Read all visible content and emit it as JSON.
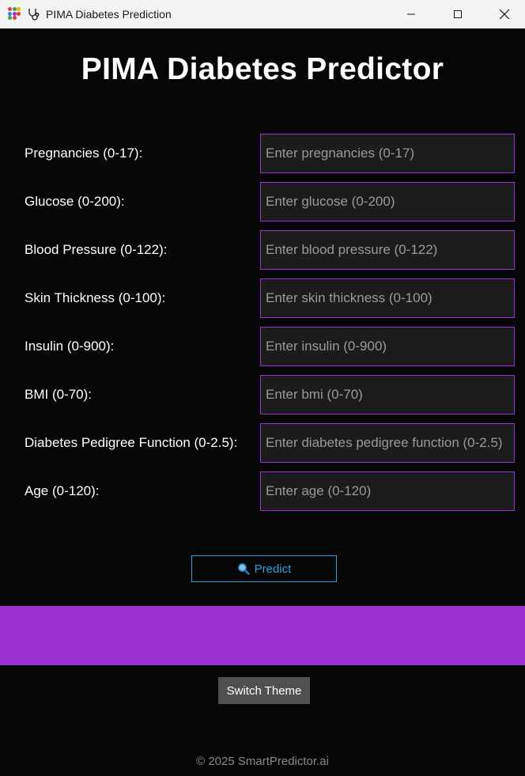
{
  "window": {
    "title": "PIMA Diabetes Prediction"
  },
  "page": {
    "title": "PIMA Diabetes Predictor"
  },
  "fields": [
    {
      "label": "Pregnancies (0-17):",
      "placeholder": "Enter pregnancies (0-17)",
      "value": ""
    },
    {
      "label": "Glucose (0-200):",
      "placeholder": "Enter glucose (0-200)",
      "value": ""
    },
    {
      "label": "Blood Pressure (0-122):",
      "placeholder": "Enter blood pressure (0-122)",
      "value": ""
    },
    {
      "label": "Skin Thickness (0-100):",
      "placeholder": "Enter skin thickness (0-100)",
      "value": ""
    },
    {
      "label": "Insulin (0-900):",
      "placeholder": "Enter insulin (0-900)",
      "value": ""
    },
    {
      "label": "BMI (0-70):",
      "placeholder": "Enter bmi (0-70)",
      "value": ""
    },
    {
      "label": "Diabetes Pedigree Function (0-2.5):",
      "placeholder": "Enter diabetes pedigree function (0-2.5)",
      "value": ""
    },
    {
      "label": "Age (0-120):",
      "placeholder": "Enter age (0-120)",
      "value": ""
    }
  ],
  "actions": {
    "predict_label": "Predict",
    "predict_icon": "magnifier-icon",
    "switch_theme_label": "Switch Theme"
  },
  "footer": {
    "text": "© 2025 SmartPredictor.ai"
  },
  "colors": {
    "background": "#060606",
    "accent_purple": "#9b30d0",
    "predict_blue": "#2f9fe0",
    "input_bg": "#1c1c1c",
    "theme_button": "#505050"
  }
}
